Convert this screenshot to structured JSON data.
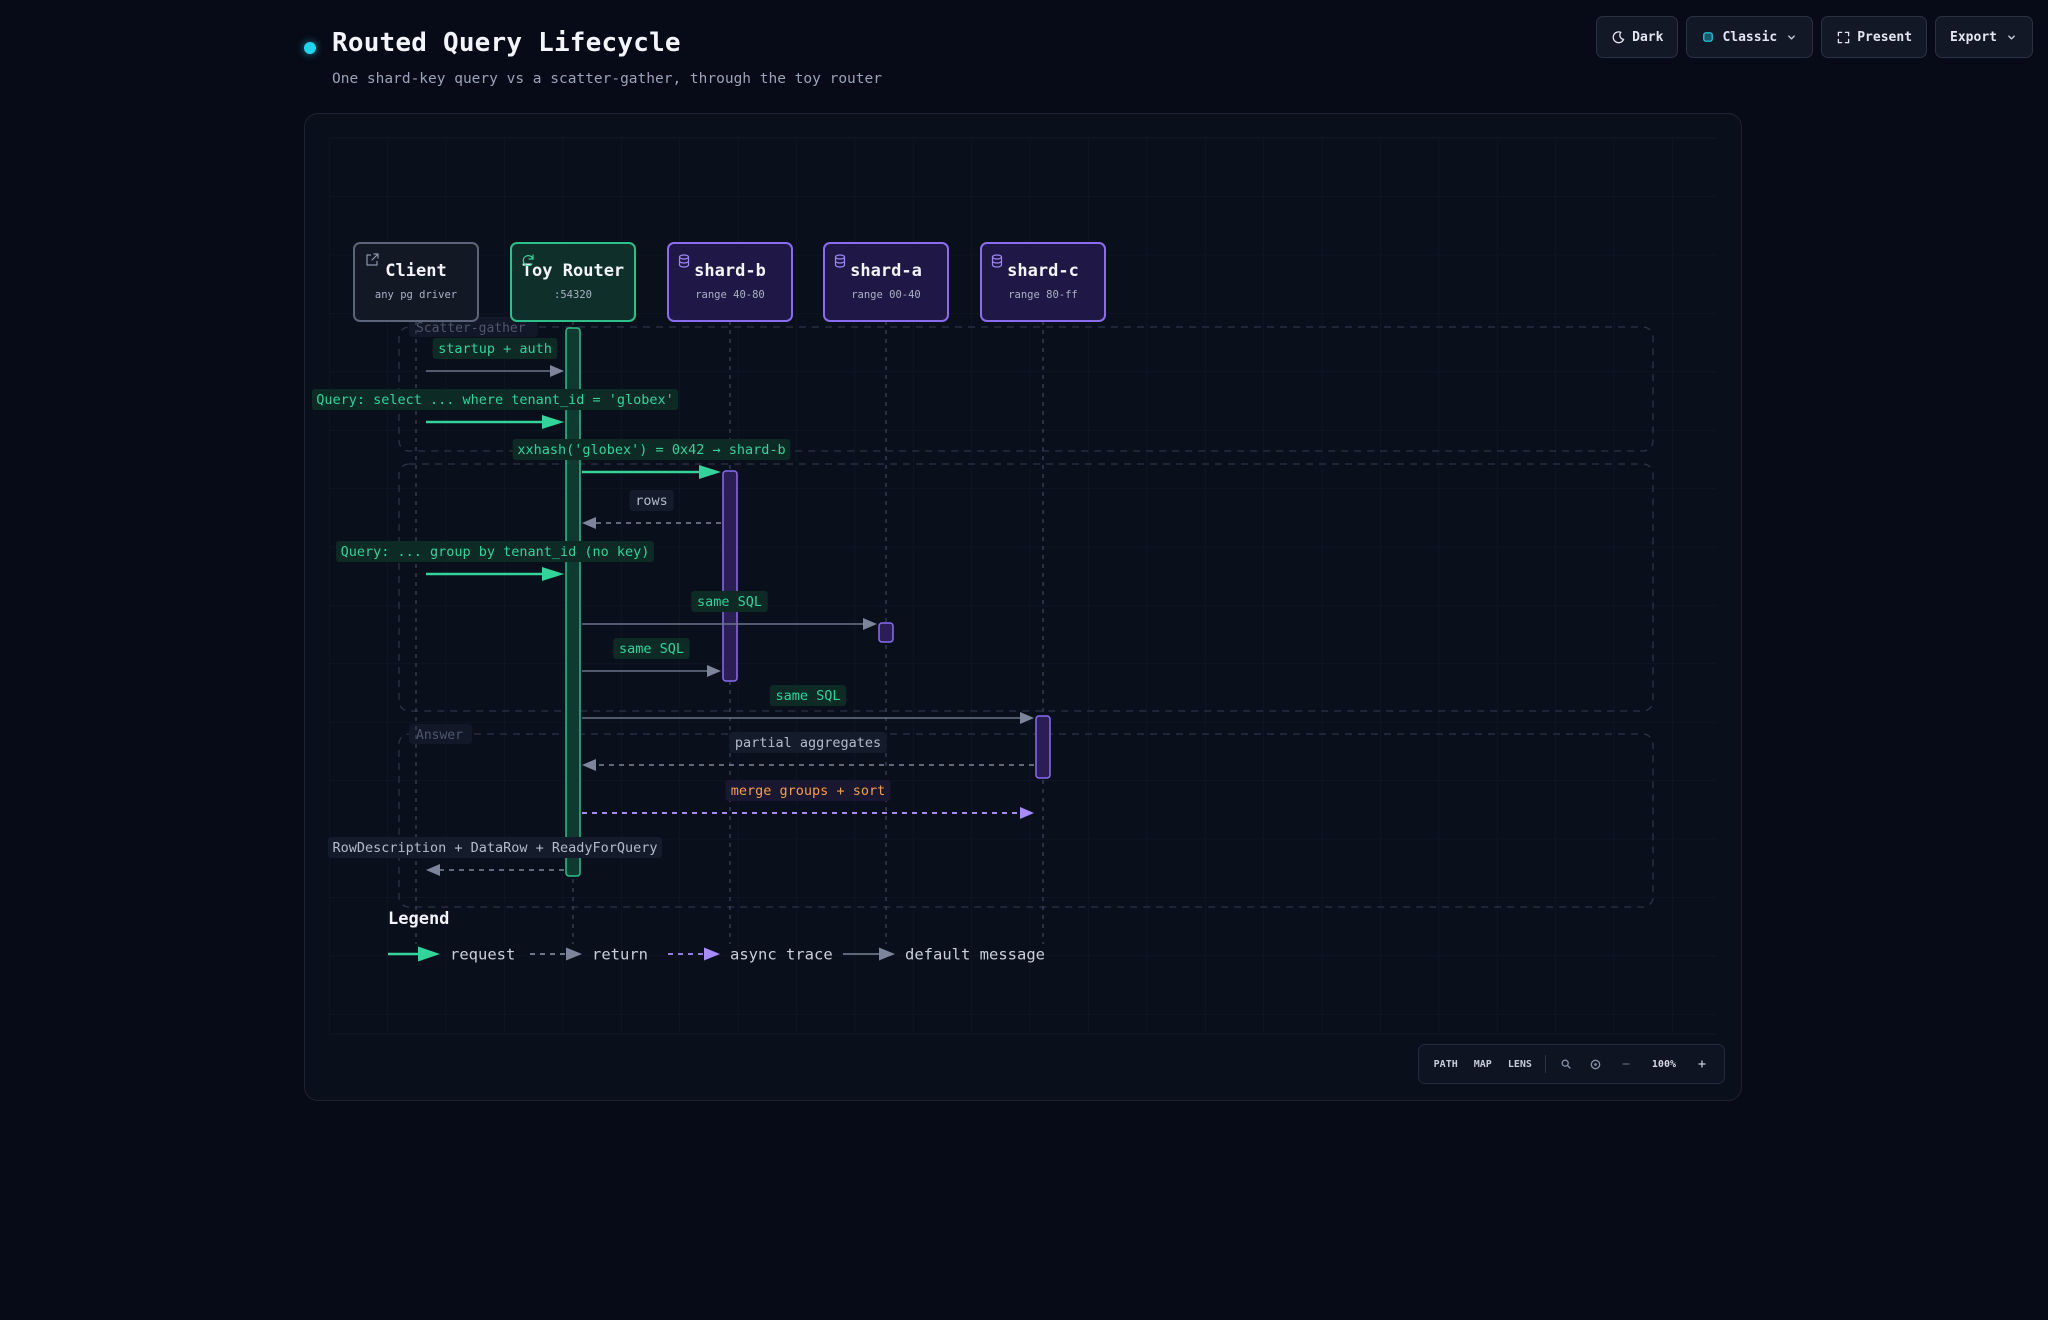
{
  "header": {
    "title": "Routed Query Lifecycle",
    "subtitle": "One shard-key query vs a scatter-gather, through the toy router"
  },
  "toolbar": {
    "theme_label": "Dark",
    "theme_icon": "moon-icon",
    "style_label": "Classic",
    "present_label": "Present",
    "present_icon": "fullscreen-icon",
    "export_label": "Export"
  },
  "colors": {
    "background": "#070b17",
    "request": "#34d399",
    "async": "#a78bfa",
    "default": "#6b7488",
    "router": "#2fbf8a",
    "shard": "#8b6cf0",
    "label_orange": "#f59e4a"
  },
  "participants": [
    {
      "name": "Client",
      "sub": "any pg driver",
      "kind": "client",
      "icon": "external-link-icon"
    },
    {
      "name": "Toy Router",
      "sub": ":54320",
      "kind": "router",
      "icon": "refresh-icon"
    },
    {
      "name": "shard-b",
      "sub": "range 40-80",
      "kind": "shard",
      "icon": "database-icon"
    },
    {
      "name": "shard-a",
      "sub": "range 00-40",
      "kind": "shard",
      "icon": "database-icon"
    },
    {
      "name": "shard-c",
      "sub": "range 80-ff",
      "kind": "shard",
      "icon": "database-icon"
    }
  ],
  "groups": [
    {
      "label": "Scatter-gather"
    },
    {
      "label": ""
    },
    {
      "label": "Answer"
    }
  ],
  "messages": [
    {
      "label": "startup + auth",
      "from": 0,
      "to": 1,
      "type": "default"
    },
    {
      "label": "Query: select ... where tenant_id = 'globex'",
      "from": 0,
      "to": 1,
      "type": "request"
    },
    {
      "label": "xxhash('globex') = 0x42 → shard-b",
      "from": 1,
      "to": 2,
      "type": "request"
    },
    {
      "label": "rows",
      "from": 2,
      "to": 1,
      "type": "return"
    },
    {
      "label": "Query: ... group by tenant_id (no key)",
      "from": 0,
      "to": 1,
      "type": "request"
    },
    {
      "label": "same SQL",
      "from": 1,
      "to": 3,
      "type": "default"
    },
    {
      "label": "same SQL",
      "from": 1,
      "to": 2,
      "type": "default"
    },
    {
      "label": "same SQL",
      "from": 1,
      "to": 4,
      "type": "default"
    },
    {
      "label": "partial aggregates",
      "from": 4,
      "to": 1,
      "type": "return"
    },
    {
      "label": "merge groups + sort",
      "from": 1,
      "to": 4,
      "type": "async"
    },
    {
      "label": "RowDescription + DataRow + ReadyForQuery",
      "from": 1,
      "to": 0,
      "type": "return"
    }
  ],
  "legend": {
    "title": "Legend",
    "items": [
      {
        "label": "request",
        "type": "request"
      },
      {
        "label": "return",
        "type": "return"
      },
      {
        "label": "async trace",
        "type": "async"
      },
      {
        "label": "default message",
        "type": "default"
      }
    ]
  },
  "zoombar": {
    "path": "PATH",
    "map": "MAP",
    "lens": "LENS",
    "zoom": "100%"
  }
}
